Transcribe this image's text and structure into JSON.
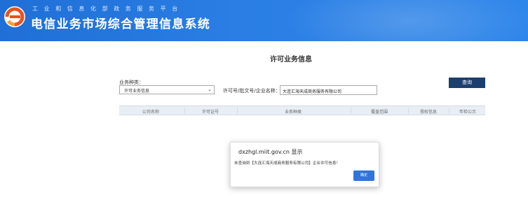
{
  "header": {
    "subtitle": "工业和信息化部政务服务平台",
    "title": "电信业务市场综合管理信息系统",
    "colors": {
      "banner": "#2a7ee4",
      "logo_orange": "#e8531f"
    }
  },
  "page": {
    "title": "许可业务信息"
  },
  "search": {
    "business_type_label": "业务种类：",
    "business_type_value": "许可业务信息",
    "keyword_label": "许可号/批文号/企业名称：",
    "keyword_value": "大连汇海天成商务服务有限公司",
    "query_label": "查询"
  },
  "table": {
    "columns": [
      "公司名称",
      "许可证号",
      "业务种类",
      "覆盖范围",
      "授权信息",
      "年检公示"
    ]
  },
  "dialog": {
    "title": "dxzhgl.miit.gov.cn 显示",
    "message": "未查询到【大连汇海天成商务服务有限公司】企业许可信息！",
    "ok_label": "确定"
  }
}
